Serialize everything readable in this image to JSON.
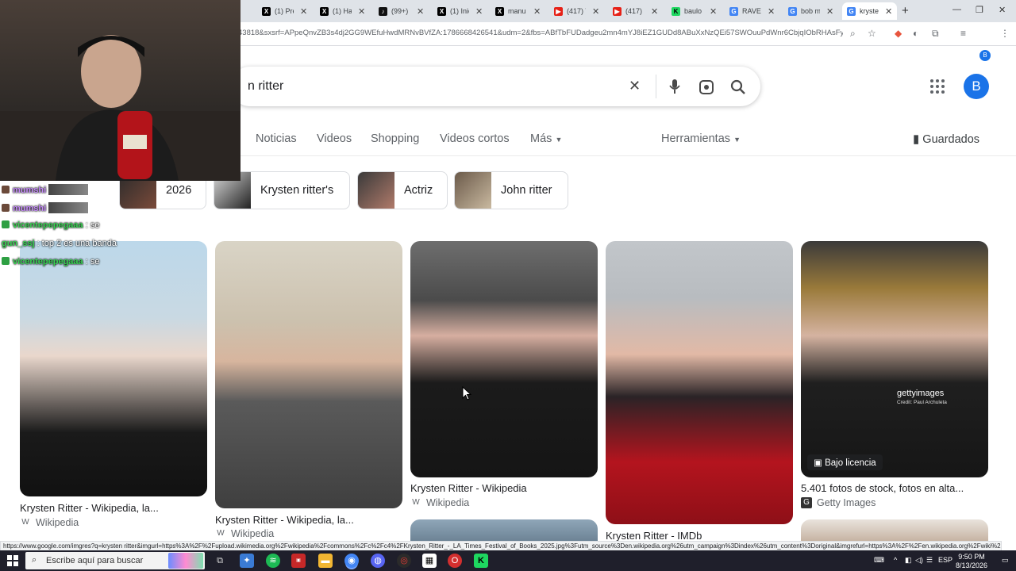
{
  "browser": {
    "tabs": [
      {
        "title": "(1) Pre",
        "icon": "x-logo-icon"
      },
      {
        "title": "(1) Han",
        "icon": "x-logo-icon"
      },
      {
        "title": "(99+) R",
        "icon": "tiktok-icon"
      },
      {
        "title": "(1) Inici",
        "icon": "x-logo-icon"
      },
      {
        "title": "manu e",
        "icon": "x-logo-icon"
      },
      {
        "title": "(417) Tl",
        "icon": "youtube-icon"
      },
      {
        "title": "(417) N",
        "icon": "youtube-icon"
      },
      {
        "title": "baulo S",
        "icon": "kick-icon"
      },
      {
        "title": "RAVEN",
        "icon": "google-icon"
      },
      {
        "title": "bob m",
        "icon": "google-icon"
      },
      {
        "title": "kryster",
        "icon": "google-icon"
      }
    ],
    "url": "43818&sxsrf=APpeQnvZB3s4dj2GG9WEfuHwdMRNvBVfZA:1786668426541&udm=2&fbs=ABfTbFUDadgeu2mn4mYJ8iEZ1GUDd8ABuXxNzQEi57SWOuuPdWnr6CbjqIObRHAsFy-UJWo...",
    "profile_initial": "B"
  },
  "search": {
    "query": "n ritter",
    "account_initial": "B"
  },
  "nav_tabs": [
    "Noticias",
    "Videos",
    "Shopping",
    "Videos cortos",
    "Más"
  ],
  "tools_label": "Herramientas",
  "saved_label": "Guardados",
  "chips": [
    "2026",
    "Krysten ritter's",
    "Actriz",
    "John ritter"
  ],
  "results": [
    {
      "caption": "Krysten Ritter - Wikipedia, la...",
      "source": "Wikipedia"
    },
    {
      "caption": "Krysten Ritter - Wikipedia, la...",
      "source": "Wikipedia"
    },
    {
      "caption": "Krysten Ritter - Wikipedia",
      "source": "Wikipedia"
    },
    {
      "caption": "Krysten Ritter - IMDb",
      "source": ""
    },
    {
      "caption": "5.401 fotos de stock, fotos en alta...",
      "source": "Getty Images"
    }
  ],
  "license_badge": "Bajo licencia",
  "getty_watermark": "gettyimages",
  "getty_credit": "Credit: Paul Archuleta",
  "chat": [
    {
      "user": "mumshi",
      "message": ""
    },
    {
      "user": "mumshi",
      "message": ""
    },
    {
      "user": "vicentepepegaaa",
      "message": ": se"
    },
    {
      "user": "gun_ssj",
      "message": ": top 2 es una banda"
    },
    {
      "user": "vicentepepegaaa",
      "message": ": se"
    }
  ],
  "status_url": "https://www.google.com/imgres?q=krysten ritter&imgurl=https%3A%2F%2Fupload.wikimedia.org%2Fwikipedia%2Fcommons%2Fc%2Fc4%2FKrysten_Ritter_-_LA_Times_Festival_of_Books_2025.jpg%3Futm_source%3Den.wikipedia.org%26utm_campaign%3Dindex%26utm_content%3Doriginal&imgrefurl=https%3A%2F%2Fen.wikipedia.org%2Fwiki%2FKry...",
  "taskbar": {
    "search_placeholder": "Escribe aquí para buscar",
    "language": "ESP",
    "time": "9:50 PM",
    "date": "8/13/2026"
  },
  "colors": {
    "accent": "#1a73e8",
    "taskbar": "#1f1f2b"
  }
}
